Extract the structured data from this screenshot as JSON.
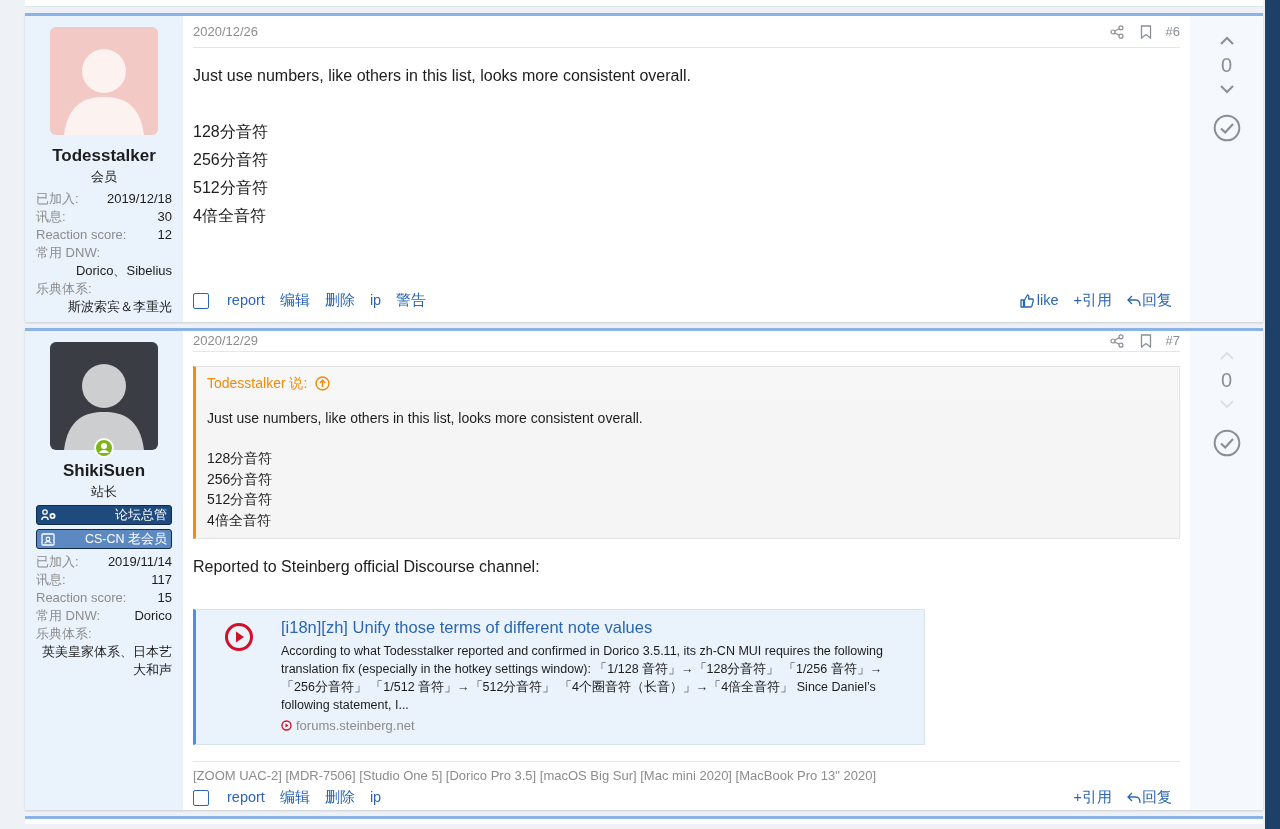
{
  "posts": [
    {
      "author": {
        "name": "Todesstalker",
        "role": "会员",
        "stats": [
          {
            "label": "已加入:",
            "value": "2019/12/18"
          },
          {
            "label": "讯息:",
            "value": "30"
          },
          {
            "label": "Reaction score:",
            "value": "12"
          },
          {
            "label": "常用 DNW:",
            "value": "Dorico、Sibelius"
          },
          {
            "label": "乐典体系:",
            "value": "斯波索宾＆李重光"
          }
        ]
      },
      "date": "2020/12/26",
      "number": "#6",
      "checked": false,
      "votes": {
        "score": "0",
        "enabled": true
      },
      "body": [
        {
          "kind": "paragraph",
          "lines": [
            "Just use numbers, like others in this list, looks more consistent overall."
          ]
        },
        {
          "kind": "paragraph",
          "lines": [
            "128分音符",
            "256分音符",
            "512分音符",
            "4倍全音符"
          ]
        }
      ],
      "actions_left": [
        "report",
        "编辑",
        "删除",
        "ip",
        "警告"
      ],
      "actions_right": [
        {
          "kind": "like",
          "label": "like"
        },
        {
          "kind": "quote",
          "label": "+引用"
        },
        {
          "kind": "reply",
          "label": "回复"
        }
      ]
    },
    {
      "author": {
        "name": "ShikiSuen",
        "role": "站长",
        "online": true,
        "banners": [
          {
            "label": "论坛总管",
            "kind": "staff",
            "color": "#1f4a7d"
          },
          {
            "label": "CS-CN 老会员",
            "kind": "member",
            "color": "#5d89c2"
          }
        ],
        "stats": [
          {
            "label": "已加入:",
            "value": "2019/11/14"
          },
          {
            "label": "讯息:",
            "value": "117"
          },
          {
            "label": "Reaction score:",
            "value": "15"
          },
          {
            "label": "常用 DNW:",
            "value": "Dorico"
          },
          {
            "label": "乐典体系:",
            "value": "英美皇家体系、日本艺大和声"
          }
        ]
      },
      "date": "2020/12/29",
      "number": "#7",
      "checked": false,
      "votes": {
        "score": "0",
        "enabled": false
      },
      "body": [
        {
          "kind": "quote",
          "author": "Todesstalker 说:",
          "paragraphs": [
            [
              "Just use numbers, like others in this list, looks more consistent overall."
            ],
            [
              "128分音符",
              "256分音符",
              "512分音符",
              "4倍全音符"
            ]
          ]
        },
        {
          "kind": "paragraph",
          "lines": [
            "Reported to Steinberg official Discourse channel:"
          ]
        },
        {
          "kind": "link_card",
          "title": "[i18n][zh] Unify those terms of different note values",
          "description": "According to what Todesstalker reported and confirmed in Dorico 3.5.11, its zh-CN MUI requires the following translation fix (especially in the hotkey settings window): 「1/128 音符」→「128分音符」 「1/256 音符」→「256分音符」 「1/512 音符」→「512分音符」 「4个圈音符（长音）」→「4倍全音符」 Since Daniel’s following statement, I...",
          "domain": "forums.steinberg.net"
        }
      ],
      "signature": "[ZOOM UAC-2] [MDR-7506] [Studio One 5] [Dorico Pro 3.5] [macOS Big Sur] [Mac mini 2020] [MacBook Pro 13\" 2020]",
      "actions_left": [
        "report",
        "编辑",
        "删除",
        "ip"
      ],
      "actions_right": [
        {
          "kind": "quote",
          "label": "+引用"
        },
        {
          "kind": "reply",
          "label": "回复"
        }
      ]
    }
  ]
}
